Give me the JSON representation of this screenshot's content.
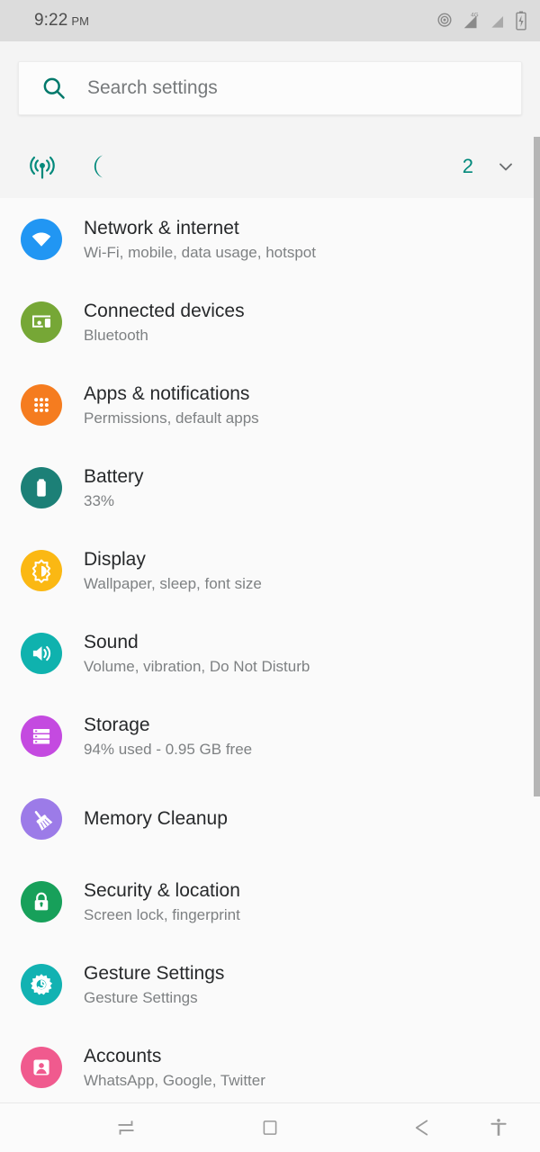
{
  "statusbar": {
    "time": "9:22",
    "ampm": "PM",
    "icons": [
      {
        "name": "hotspot-icon",
        "label": "hotspot"
      },
      {
        "name": "signal-4g-icon",
        "label": "4G"
      },
      {
        "name": "signal-bars-icon",
        "label": "signal"
      },
      {
        "name": "battery-charging-icon",
        "label": "battery charging"
      }
    ]
  },
  "search": {
    "placeholder": "Search settings",
    "icon": "search-icon",
    "accent": "#00796B"
  },
  "toggles": {
    "items": [
      {
        "name": "hotspot-toggle",
        "icon": "hotspot-icon",
        "color": "#00897B"
      },
      {
        "name": "night-mode-toggle",
        "icon": "moon-icon",
        "color": "#00897B"
      }
    ],
    "count": "2",
    "expand_icon": "chevron-down-icon",
    "count_color": "#00897B"
  },
  "settings": {
    "items": [
      {
        "name": "network-internet",
        "title": "Network & internet",
        "subtitle": "Wi-Fi, mobile, data usage, hotspot",
        "icon": "wifi-icon",
        "color": "#2196F3"
      },
      {
        "name": "connected-devices",
        "title": "Connected devices",
        "subtitle": "Bluetooth",
        "icon": "devices-icon",
        "color": "#76A736"
      },
      {
        "name": "apps-notifications",
        "title": "Apps & notifications",
        "subtitle": "Permissions, default apps",
        "icon": "apps-grid-icon",
        "color": "#F57C1F"
      },
      {
        "name": "battery",
        "title": "Battery",
        "subtitle": "33%",
        "icon": "battery-icon",
        "color": "#1C8077"
      },
      {
        "name": "display",
        "title": "Display",
        "subtitle": "Wallpaper, sleep, font size",
        "icon": "brightness-icon",
        "color": "#FBB813"
      },
      {
        "name": "sound",
        "title": "Sound",
        "subtitle": "Volume, vibration, Do Not Disturb",
        "icon": "speaker-icon",
        "color": "#0FB2AE"
      },
      {
        "name": "storage",
        "title": "Storage",
        "subtitle": "94% used - 0.95 GB free",
        "icon": "storage-icon",
        "color": "#C44AE0"
      },
      {
        "name": "memory-cleanup",
        "title": "Memory Cleanup",
        "subtitle": "",
        "icon": "broom-icon",
        "color": "#9C7BE8"
      },
      {
        "name": "security-location",
        "title": "Security & location",
        "subtitle": "Screen lock, fingerprint",
        "icon": "lock-icon",
        "color": "#17A05A"
      },
      {
        "name": "gesture-settings",
        "title": "Gesture Settings",
        "subtitle": "Gesture Settings",
        "icon": "gear-icon",
        "color": "#12B2B2"
      },
      {
        "name": "accounts",
        "title": "Accounts",
        "subtitle": "WhatsApp, Google, Twitter",
        "icon": "account-icon",
        "color": "#F05A8E"
      }
    ]
  },
  "navbar": {
    "buttons": [
      {
        "name": "recents-button",
        "icon": "switch-icon"
      },
      {
        "name": "home-button",
        "icon": "square-icon"
      },
      {
        "name": "back-button",
        "icon": "arrow-left-icon"
      },
      {
        "name": "accessibility-button",
        "icon": "accessibility-icon"
      }
    ]
  }
}
